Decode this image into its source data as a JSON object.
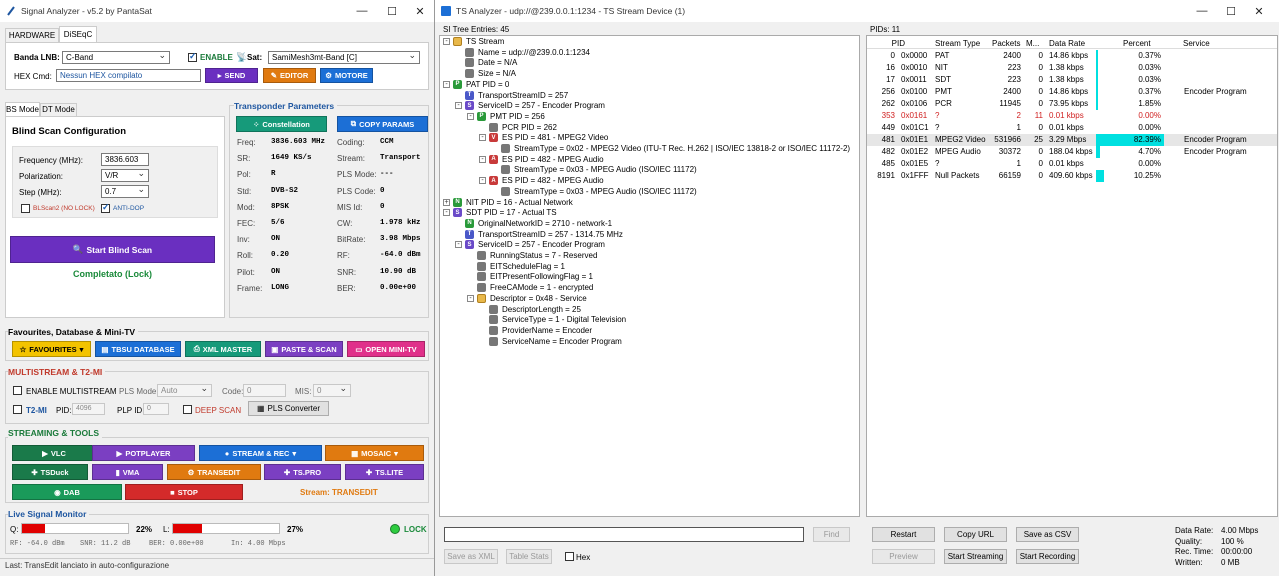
{
  "left_window": {
    "title": "Signal Analyzer - v5.2 by PantaSat",
    "tabs": [
      "HARDWARE",
      "DiSEqC"
    ],
    "lnb_label": "Banda LNB:",
    "lnb_value": "C-Band",
    "enable_label": "ENABLE",
    "sat_label": "Sat:",
    "sat_value": "SamiMesh3mt-Band [C]",
    "hex_label": "HEX Cmd:",
    "hex_value": "Nessun HEX compilato",
    "send_label": "SEND",
    "editor_label": "EDITOR",
    "motore_label": "MOTORE",
    "mode_tabs": [
      "BS Mode",
      "DT Mode"
    ],
    "blind_title": "Blind Scan Configuration",
    "freq_label": "Frequency (MHz):",
    "freq_value": "3836.603",
    "pol_label": "Polarization:",
    "pol_value": "V/R",
    "step_label": "Step (MHz):",
    "step_value": "0.7",
    "blscan2_label": "BLScan2 (NO LOCK)",
    "antidop_label": "ANTI-DOP",
    "start_blind_label": "Start Blind Scan",
    "completed_label": "Completato (Lock)",
    "transponder_title": "Transponder Parameters",
    "constellation_label": "Constellation",
    "copy_params_label": "COPY PARAMS",
    "params_left": [
      {
        "k": "Freq:",
        "v": "3836.603 MHz"
      },
      {
        "k": "SR:",
        "v": "1649 KS/s"
      },
      {
        "k": "Pol:",
        "v": "R"
      },
      {
        "k": "Std:",
        "v": "DVB-S2"
      },
      {
        "k": "Mod:",
        "v": "8PSK"
      },
      {
        "k": "FEC:",
        "v": "5/6"
      },
      {
        "k": "Inv:",
        "v": "ON"
      },
      {
        "k": "Roll:",
        "v": "0.20"
      },
      {
        "k": "Pilot:",
        "v": "ON"
      },
      {
        "k": "Frame:",
        "v": "LONG"
      }
    ],
    "params_right": [
      {
        "k": "Coding:",
        "v": "CCM"
      },
      {
        "k": "Stream:",
        "v": "Transport"
      },
      {
        "k": "PLS Mode:",
        "v": "---"
      },
      {
        "k": "PLS Code:",
        "v": "0"
      },
      {
        "k": "MIS Id:",
        "v": "0"
      },
      {
        "k": "CW:",
        "v": "1.978 kHz"
      },
      {
        "k": "BitRate:",
        "v": "3.98 Mbps"
      },
      {
        "k": "RF:",
        "v": "-64.0 dBm"
      },
      {
        "k": "SNR:",
        "v": "10.90 dB"
      },
      {
        "k": "BER:",
        "v": "0.00e+00"
      }
    ],
    "fav_title": "Favourites, Database & Mini-TV",
    "favourites_label": "FAVOURITES",
    "tbsu_label": "TBSU DATABASE",
    "xml_master_label": "XML MASTER",
    "paste_scan_label": "PASTE & SCAN",
    "open_minitv_label": "OPEN MINI-TV",
    "multistream_title": "MULTISTREAM & T2-MI",
    "enable_multistream_label": "ENABLE MULTISTREAM",
    "pls_mode_label": "PLS Mode:",
    "pls_mode_value": "Auto",
    "code_label": "Code:",
    "code_value": "0",
    "mis_label": "MIS:",
    "mis_value": "0",
    "t2mi_label": "T2-MI",
    "pid_label": "PID:",
    "pid_value": "4096",
    "plp_label": "PLP ID:",
    "plp_value": "0",
    "deep_scan_label": "DEEP SCAN",
    "pls_converter_label": "PLS Converter",
    "streaming_title": "STREAMING & TOOLS",
    "tools": {
      "vlc": "VLC",
      "potplayer": "POTPLAYER",
      "stream_rec": "STREAM & REC",
      "mosaic": "MOSAIC",
      "tsduck": "TSDuck",
      "vma": "VMA",
      "transedit": "TRANSEDIT",
      "tspro": "TS.PRO",
      "tslite": "TS.LITE",
      "dab": "DAB",
      "stop": "STOP"
    },
    "stream_status": "Stream: TRANSEDIT",
    "monitor_title": "Live Signal Monitor",
    "q_label": "Q:",
    "q_value": "22%",
    "q_level": 0.22,
    "l_label": "L:",
    "l_value": "27%",
    "l_level": 0.27,
    "lock_label": "LOCK",
    "monitor_stats": [
      "RF: -64.0 dBm",
      "SNR: 11.2 dB",
      "BER: 0.00e+00",
      "In: 4.00 Mbps"
    ],
    "status_bar": "Last:  TransEdit lanciato in auto-configurazione"
  },
  "right_window": {
    "title": "TS Analyzer - udp://@239.0.0.1:1234 - TS Stream Device (1)",
    "si_header": "SI Tree Entries: 45",
    "pids_header": "PIDs: 11",
    "tree": [
      {
        "d": 0,
        "t": "TS Stream",
        "ic": "folder",
        "ex": "-"
      },
      {
        "d": 1,
        "t": "Name = udp://@239.0.0.1:1234",
        "ic": "leaf"
      },
      {
        "d": 1,
        "t": "Date = N/A",
        "ic": "leaf"
      },
      {
        "d": 1,
        "t": "Size = N/A",
        "ic": "leaf"
      },
      {
        "d": 0,
        "t": "PAT PID = 0",
        "ic": "P",
        "ex": "-"
      },
      {
        "d": 1,
        "t": "TransportStreamID = 257",
        "ic": "T"
      },
      {
        "d": 1,
        "t": "ServiceID = 257 - Encoder Program",
        "ic": "S",
        "ex": "-"
      },
      {
        "d": 2,
        "t": "PMT PID = 256",
        "ic": "P",
        "ex": "-"
      },
      {
        "d": 3,
        "t": "PCR PID = 262",
        "ic": "leaf"
      },
      {
        "d": 3,
        "t": "ES PID = 481 - MPEG2 Video",
        "ic": "V",
        "ex": "-"
      },
      {
        "d": 4,
        "t": "StreamType = 0x02 - MPEG2 Video (ITU-T Rec. H.262 | ISO/IEC 13818-2 or ISO/IEC 11172-2)",
        "ic": "leaf"
      },
      {
        "d": 3,
        "t": "ES PID = 482 - MPEG Audio",
        "ic": "A",
        "ex": "-"
      },
      {
        "d": 4,
        "t": "StreamType = 0x03 - MPEG Audio (ISO/IEC 11172)",
        "ic": "leaf"
      },
      {
        "d": 3,
        "t": "ES PID = 482 - MPEG Audio",
        "ic": "A",
        "ex": "-"
      },
      {
        "d": 4,
        "t": "StreamType = 0x03 - MPEG Audio (ISO/IEC 11172)",
        "ic": "leaf"
      },
      {
        "d": 0,
        "t": "NIT PID = 16 - Actual Network",
        "ic": "N",
        "ex": "+"
      },
      {
        "d": 0,
        "t": "SDT PID = 17 - Actual TS",
        "ic": "S",
        "ex": "-"
      },
      {
        "d": 1,
        "t": "OriginalNetworkID = 2710 - network-1",
        "ic": "N"
      },
      {
        "d": 1,
        "t": "TransportStreamID = 257 - 1314.75 MHz",
        "ic": "T"
      },
      {
        "d": 1,
        "t": "ServiceID = 257 - Encoder Program",
        "ic": "S",
        "ex": "-"
      },
      {
        "d": 2,
        "t": "RunningStatus = 7 - Reserved",
        "ic": "leaf"
      },
      {
        "d": 2,
        "t": "EITScheduleFlag = 1",
        "ic": "leaf"
      },
      {
        "d": 2,
        "t": "EITPresentFollowingFlag = 1",
        "ic": "leaf"
      },
      {
        "d": 2,
        "t": "FreeCAMode = 1 - encrypted",
        "ic": "leaf"
      },
      {
        "d": 2,
        "t": "Descriptor = 0x48 - Service",
        "ic": "folder",
        "ex": "-"
      },
      {
        "d": 3,
        "t": "DescriptorLength = 25",
        "ic": "leaf"
      },
      {
        "d": 3,
        "t": "ServiceType = 1 - Digital Television",
        "ic": "leaf"
      },
      {
        "d": 3,
        "t": "ProviderName = Encoder",
        "ic": "leaf"
      },
      {
        "d": 3,
        "t": "ServiceName = Encoder Program",
        "ic": "leaf"
      }
    ],
    "pid_columns": [
      "PID",
      "Stream Type",
      "Packets",
      "M...",
      "Data Rate",
      "Percent",
      "Service"
    ],
    "pid_rows": [
      {
        "pid": "0",
        "hex": "0x0000",
        "type": "PAT",
        "packets": "2400",
        "m": "0",
        "rate": "14.86 kbps",
        "pct": "0.37%",
        "p": 0.0037,
        "service": "",
        "err": false
      },
      {
        "pid": "16",
        "hex": "0x0010",
        "type": "NIT",
        "packets": "223",
        "m": "0",
        "rate": "1.38 kbps",
        "pct": "0.03%",
        "p": 0.0003,
        "service": "",
        "err": false
      },
      {
        "pid": "17",
        "hex": "0x0011",
        "type": "SDT",
        "packets": "223",
        "m": "0",
        "rate": "1.38 kbps",
        "pct": "0.03%",
        "p": 0.0003,
        "service": "",
        "err": false
      },
      {
        "pid": "256",
        "hex": "0x0100",
        "type": "PMT",
        "packets": "2400",
        "m": "0",
        "rate": "14.86 kbps",
        "pct": "0.37%",
        "p": 0.0037,
        "service": "Encoder Program",
        "err": false
      },
      {
        "pid": "262",
        "hex": "0x0106",
        "type": "PCR",
        "packets": "11945",
        "m": "0",
        "rate": "73.95 kbps",
        "pct": "1.85%",
        "p": 0.0185,
        "service": "",
        "err": false
      },
      {
        "pid": "353",
        "hex": "0x0161",
        "type": "?",
        "packets": "2",
        "m": "11",
        "rate": "0.01 kbps",
        "pct": "0.00%",
        "p": 0,
        "service": "",
        "err": true
      },
      {
        "pid": "449",
        "hex": "0x01C1",
        "type": "?",
        "packets": "1",
        "m": "0",
        "rate": "0.01 kbps",
        "pct": "0.00%",
        "p": 0,
        "service": "",
        "err": false
      },
      {
        "pid": "481",
        "hex": "0x01E1",
        "type": "MPEG2 Video",
        "packets": "531966",
        "m": "25",
        "rate": "3.29 Mbps",
        "pct": "82.39%",
        "p": 0.8239,
        "service": "Encoder Program",
        "err": false
      },
      {
        "pid": "482",
        "hex": "0x01E2",
        "type": "MPEG Audio",
        "packets": "30372",
        "m": "0",
        "rate": "188.04 kbps",
        "pct": "4.70%",
        "p": 0.047,
        "service": "Encoder Program",
        "err": false
      },
      {
        "pid": "485",
        "hex": "0x01E5",
        "type": "?",
        "packets": "1",
        "m": "0",
        "rate": "0.01 kbps",
        "pct": "0.00%",
        "p": 0,
        "service": "",
        "err": false
      },
      {
        "pid": "8191",
        "hex": "0x1FFF",
        "type": "Null Packets",
        "packets": "66159",
        "m": "0",
        "rate": "409.60 kbps",
        "pct": "10.25%",
        "p": 0.1025,
        "service": "",
        "err": false
      }
    ],
    "find_label": "Find",
    "save_xml_label": "Save as XML",
    "table_stats_label": "Table Stats",
    "hex_label": "Hex",
    "restart_label": "Restart",
    "copy_url_label": "Copy URL",
    "save_csv_label": "Save as CSV",
    "preview_label": "Preview",
    "start_streaming_label": "Start Streaming",
    "start_recording_label": "Start Recording",
    "stats": [
      {
        "k": "Data Rate:",
        "v": "4.00 Mbps"
      },
      {
        "k": "Quality:",
        "v": "100 %"
      },
      {
        "k": "Rec. Time:",
        "v": "00:00:00"
      },
      {
        "k": "Written:",
        "v": "0 MB"
      }
    ]
  }
}
